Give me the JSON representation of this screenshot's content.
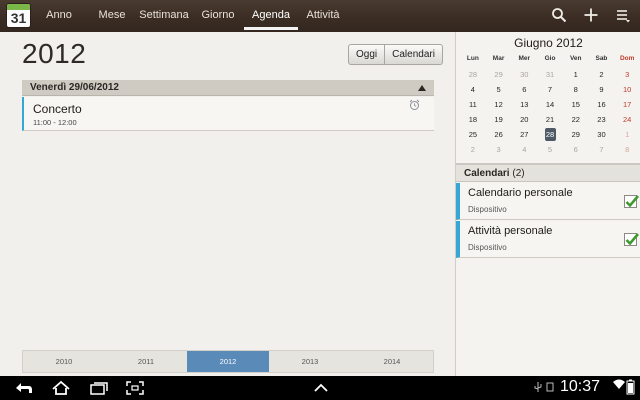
{
  "app": {
    "icon_number": "31",
    "icon_name": "calendar-app-icon"
  },
  "tabs": [
    {
      "label": "Anno",
      "active": false
    },
    {
      "label": "Mese",
      "active": false
    },
    {
      "label": "Settimana",
      "active": false
    },
    {
      "label": "Giorno",
      "active": false
    },
    {
      "label": "Agenda",
      "active": true
    },
    {
      "label": "Attività",
      "active": false
    }
  ],
  "actions": {
    "search": "search-icon",
    "add": "plus-icon",
    "menu": "overflow-menu-icon"
  },
  "agenda": {
    "year": "2012",
    "today_button": "Oggi",
    "calendars_button": "Calendari",
    "date_header": "Venerdì 29/06/2012",
    "events": [
      {
        "title": "Concerto",
        "time": "11:00 - 12:00",
        "icon": "alarm-clock-icon"
      }
    ],
    "year_strip": [
      "2010",
      "2011",
      "2012",
      "2013",
      "2014"
    ],
    "selected_year_index": 2
  },
  "mini_calendar": {
    "title": "Giugno 2012",
    "weekdays": [
      "Lun",
      "Mar",
      "Mer",
      "Gio",
      "Ven",
      "Sab",
      "Dom"
    ],
    "weeks": [
      [
        "28",
        "29",
        "30",
        "31",
        "1",
        "2",
        "3"
      ],
      [
        "4",
        "5",
        "6",
        "7",
        "8",
        "9",
        "10"
      ],
      [
        "11",
        "12",
        "13",
        "14",
        "15",
        "16",
        "17"
      ],
      [
        "18",
        "19",
        "20",
        "21",
        "22",
        "23",
        "24"
      ],
      [
        "25",
        "26",
        "27",
        "28",
        "29",
        "30",
        "1"
      ],
      [
        "2",
        "3",
        "4",
        "5",
        "6",
        "7",
        "8"
      ]
    ],
    "outside_month": [
      [
        0,
        0
      ],
      [
        0,
        1
      ],
      [
        0,
        2
      ],
      [
        0,
        3
      ],
      [
        4,
        6
      ],
      [
        5,
        0
      ],
      [
        5,
        1
      ],
      [
        5,
        2
      ],
      [
        5,
        3
      ],
      [
        5,
        4
      ],
      [
        5,
        5
      ],
      [
        5,
        6
      ]
    ],
    "today": [
      4,
      3
    ]
  },
  "calendars_panel": {
    "label": "Calendari",
    "count": "(2)",
    "items": [
      {
        "name": "Calendario personale",
        "source": "Dispositivo",
        "checked": true
      },
      {
        "name": "Attività personale",
        "source": "Dispositivo",
        "checked": true
      }
    ]
  },
  "system_bar": {
    "time": "10:37"
  },
  "colors": {
    "accent": "#35a7d6",
    "selected_year": "#5a8ab8",
    "sunday": "#c0392b",
    "topbar": "#3b2d24"
  }
}
